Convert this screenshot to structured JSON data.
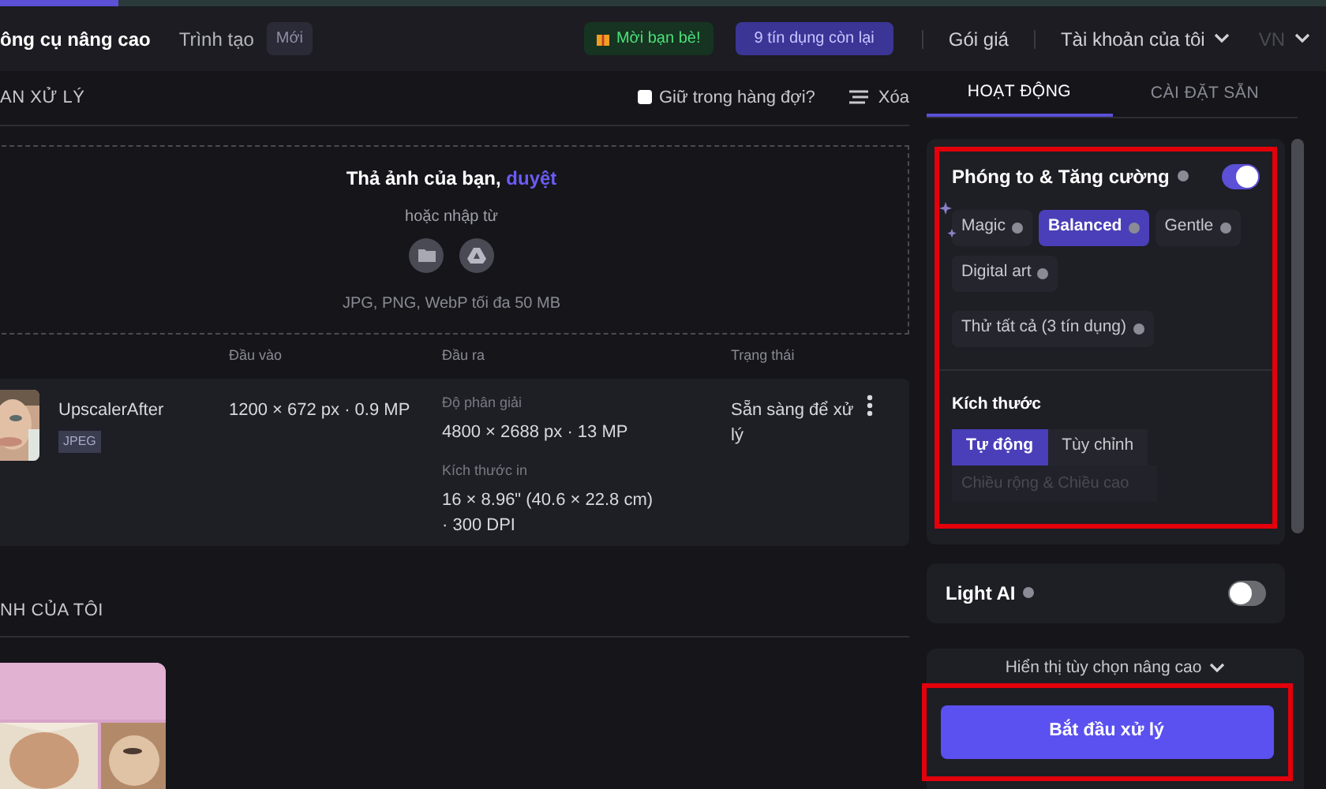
{
  "nav": {
    "items": [
      {
        "label": "ông cụ nâng cao",
        "selected": true
      },
      {
        "label": "Trình tạo",
        "selected": false
      }
    ],
    "new_badge": "Mới",
    "invite": "Mời bạn bè!",
    "credits": "9 tín dụng còn lại",
    "pricing": "Gói giá",
    "account": "Tài khoản của tôi",
    "language": "VN"
  },
  "queue": {
    "title": "AN XỬ LÝ",
    "keep_in_queue": {
      "label": "Giữ trong hàng đợi?",
      "checked": false
    },
    "clear": "Xóa"
  },
  "dropzone": {
    "prompt": "Thả ảnh của bạn, **duyệt**",
    "or_import": "hoặc nhập từ",
    "formats": "JPG, PNG, WebP tối đa 50 MB"
  },
  "table": {
    "columns": [
      "Đầu vào",
      "Đầu ra",
      "Trạng thái"
    ],
    "rows": [
      {
        "name": "UpscalerAfter",
        "format": "JPEG",
        "input": "1200 × 672 px · 0.9 MP",
        "resolution_label": "Độ phân giải",
        "resolution": "4800 × 2688 px · 13 MP",
        "print_label": "Kích thước in",
        "print_size": "16 × 8.96\" (40.6 × 22.8 cm) · 300 DPI",
        "status": "Sẵn sàng để xử lý"
      }
    ]
  },
  "my_images": {
    "title": "NH CỦA TÔI"
  },
  "panel": {
    "tabs": [
      {
        "label": "HOẠT ĐỘNG",
        "selected": true
      },
      {
        "label": "CÀI ĐẶT SẴN",
        "selected": false
      }
    ],
    "enhance": {
      "title": "Phóng to & Tăng cường",
      "on": true,
      "modes": [
        {
          "label": "Magic",
          "selected": false
        },
        {
          "label": "Balanced",
          "selected": true
        },
        {
          "label": "Gentle",
          "selected": false
        },
        {
          "label": "Digital art",
          "selected": false
        },
        {
          "label": "Thử tất cả (3 tín dụng)",
          "selected": false
        }
      ],
      "size_title": "Kích thước",
      "size_options": [
        {
          "label": "Tự động",
          "selected": true
        },
        {
          "label": "Tùy chỉnh",
          "selected": false
        }
      ],
      "size_placeholder": "Chiều rộng & Chiều cao"
    },
    "light_ai": {
      "title": "Light AI",
      "on": false
    },
    "advanced": "Hiển thị tùy chọn nâng cao",
    "start": "Bắt đầu xử lý"
  }
}
